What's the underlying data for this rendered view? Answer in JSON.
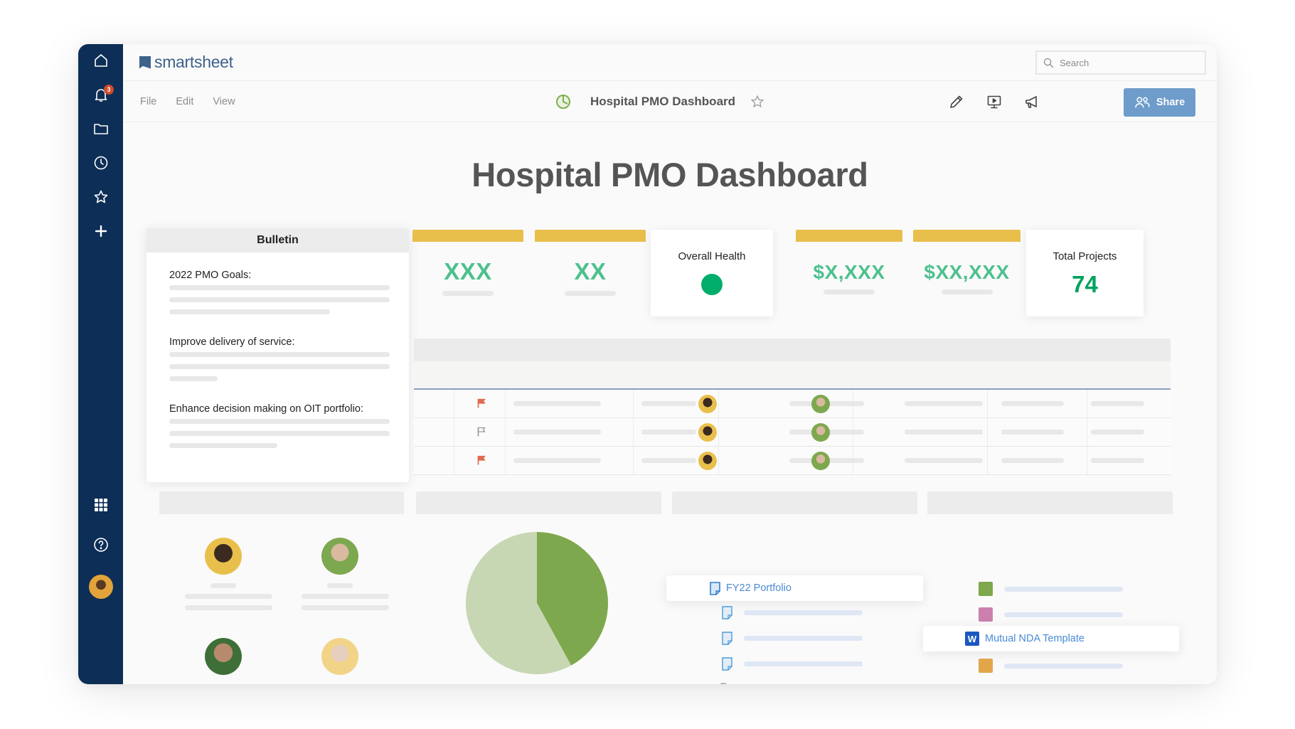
{
  "app": {
    "brand": "smartsheet",
    "notifications_count": "3"
  },
  "sidebar": {
    "items": [
      {
        "name": "home",
        "icon": "home-icon"
      },
      {
        "name": "notifications",
        "icon": "bell-icon"
      },
      {
        "name": "browse",
        "icon": "folder-icon"
      },
      {
        "name": "recents",
        "icon": "clock-icon"
      },
      {
        "name": "favorites",
        "icon": "star-icon"
      },
      {
        "name": "create",
        "icon": "plus-icon"
      }
    ],
    "bottom_items": [
      {
        "name": "launcher",
        "icon": "apps-grid-icon"
      },
      {
        "name": "help",
        "icon": "help-icon"
      },
      {
        "name": "account",
        "icon": "user-avatar"
      }
    ]
  },
  "search": {
    "placeholder": "Search",
    "value": ""
  },
  "toolbar": {
    "menu": [
      "File",
      "Edit",
      "View"
    ],
    "doc_title": "Hospital PMO Dashboard",
    "share_label": "Share",
    "icons": [
      "pencil-icon",
      "present-icon",
      "megaphone-icon"
    ]
  },
  "dashboard": {
    "title": "Hospital PMO Dashboard",
    "bulletin": {
      "title": "Bulletin",
      "sections": [
        {
          "label": "2022 PMO Goals:"
        },
        {
          "label": "Improve delivery of service:"
        },
        {
          "label": "Enhance decision making on OIT portfolio:"
        }
      ]
    },
    "metrics": [
      {
        "value": "XXX"
      },
      {
        "value": "XX"
      },
      {
        "value": "$X,XXX"
      },
      {
        "value": "$XX,XXX"
      }
    ],
    "overall_health": {
      "label": "Overall Health",
      "status": "green",
      "color": "#00ad6a"
    },
    "total_projects": {
      "label": "Total Projects",
      "value": "74"
    },
    "grid_rows": [
      {
        "flag": "flagged"
      },
      {
        "flag": "unflagged"
      },
      {
        "flag": "flagged"
      }
    ],
    "links": {
      "portfolio": "FY22 Portfolio",
      "nda": "Mutual NDA Template"
    },
    "colors": {
      "accent_green": "#4dc18d",
      "flag_red": "#e06a4e",
      "metric_bar": "#e9bf4c",
      "sidebar": "#0d2e56",
      "share_button": "#6e9ccb"
    }
  },
  "chart_data": {
    "type": "pie",
    "title": "",
    "slices": [
      {
        "label": "",
        "value": 42,
        "color": "#7ea84d"
      },
      {
        "label": "",
        "value": 58,
        "color": "#c7d7b3"
      }
    ]
  }
}
